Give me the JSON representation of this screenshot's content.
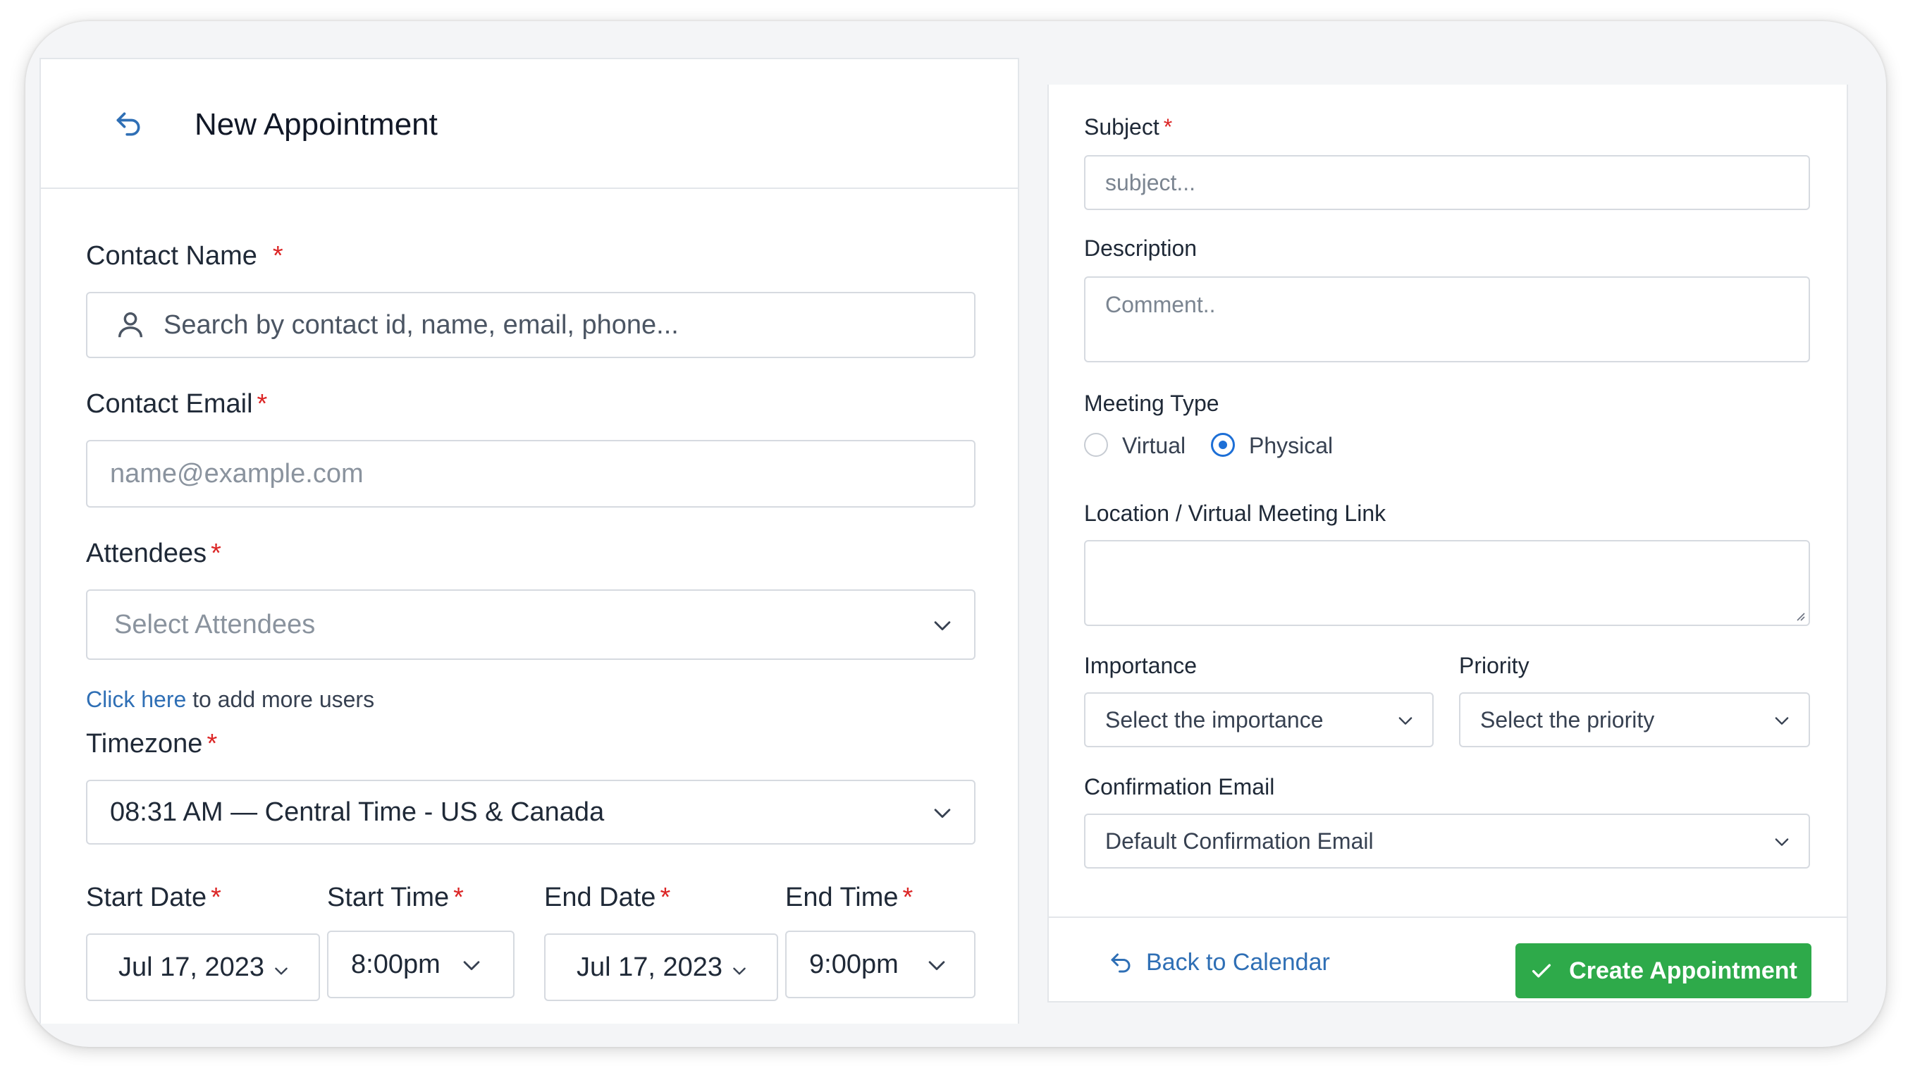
{
  "header": {
    "title": "New Appointment"
  },
  "contact_name": {
    "label": "Contact Name",
    "required": "*",
    "placeholder": "Search by contact id, name, email, phone..."
  },
  "contact_email": {
    "label": "Contact Email",
    "required": "*",
    "placeholder": "name@example.com"
  },
  "attendees": {
    "label": "Attendees",
    "required": "*",
    "placeholder": "Select Attendees",
    "help_link": "Click here",
    "help_text": " to add more users"
  },
  "timezone": {
    "label": "Timezone",
    "required": "*",
    "value": "08:31 AM — Central Time - US & Canada"
  },
  "schedule": {
    "start_date": {
      "label": "Start Date",
      "required": "*",
      "value": "Jul 17, 2023"
    },
    "start_time": {
      "label": "Start Time",
      "required": "*",
      "value": "8:00pm"
    },
    "end_date": {
      "label": "End Date",
      "required": "*",
      "value": "Jul 17, 2023"
    },
    "end_time": {
      "label": "End Time",
      "required": "*",
      "value": "9:00pm"
    }
  },
  "subject": {
    "label": "Subject",
    "required": "*",
    "placeholder": "subject..."
  },
  "description": {
    "label": "Description",
    "placeholder": "Comment.."
  },
  "meeting_type": {
    "label": "Meeting Type",
    "options": [
      "Virtual",
      "Physical"
    ],
    "selected": "Physical"
  },
  "location": {
    "label": "Location / Virtual Meeting Link",
    "value": ""
  },
  "importance": {
    "label": "Importance",
    "placeholder": "Select the importance"
  },
  "priority": {
    "label": "Priority",
    "placeholder": "Select the priority"
  },
  "confirmation_email": {
    "label": "Confirmation Email",
    "value": "Default Confirmation Email"
  },
  "footer": {
    "back_label": "Back to Calendar",
    "create_label": "Create Appointment"
  },
  "colors": {
    "accent_blue": "#2f6fb5",
    "radio_blue": "#1d6fd6",
    "success_green": "#2eaa4a",
    "required_red": "#dc2626"
  }
}
